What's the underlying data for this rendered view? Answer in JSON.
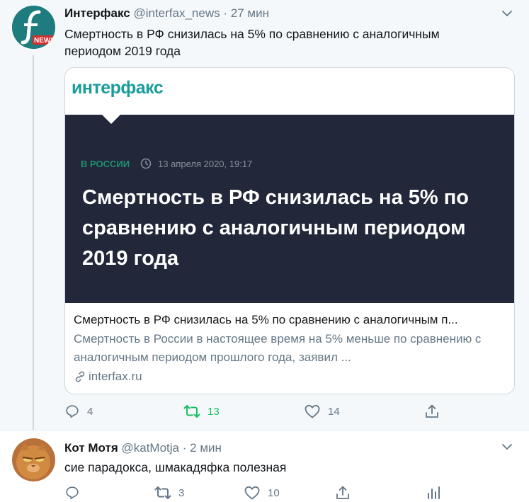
{
  "tweet1": {
    "name": "Интерфакс",
    "handle": "@interfax_news",
    "separator": "·",
    "time": "27 мин",
    "text": "Смертность в РФ снизилась на 5% по сравнению с аналогичным периодом 2019 года",
    "avatar_label": "NEWS",
    "card": {
      "logo": "интерфакс",
      "section": "В РОССИИ",
      "date": "13 апреля 2020, 19:17",
      "headline": "Смертность  в РФ снизилась на 5% по сравнению с аналогичным периодом 2019 года",
      "title": "Смертность в РФ снизилась на 5% по сравнению с аналогичным п...",
      "description": "Смертность в России в настоящее время на 5% меньше по сравнению с аналогичным периодом прошлого года, заявил ...",
      "domain": "interfax.ru"
    },
    "actions": {
      "replies": "4",
      "retweets": "13",
      "likes": "14"
    }
  },
  "tweet2": {
    "name": "Кот Мотя",
    "handle": "@katMotja",
    "separator": "·",
    "time": "2 мин",
    "text": "сие парадокса, шмакадяфка полезная",
    "actions": {
      "replies": "",
      "retweets": "3",
      "likes": "10"
    }
  },
  "colors": {
    "retweet_active": "#17bf63",
    "card_dark": "#22283a",
    "interfax_teal": "#1a9c9c",
    "section_green": "#1d8f6e"
  }
}
